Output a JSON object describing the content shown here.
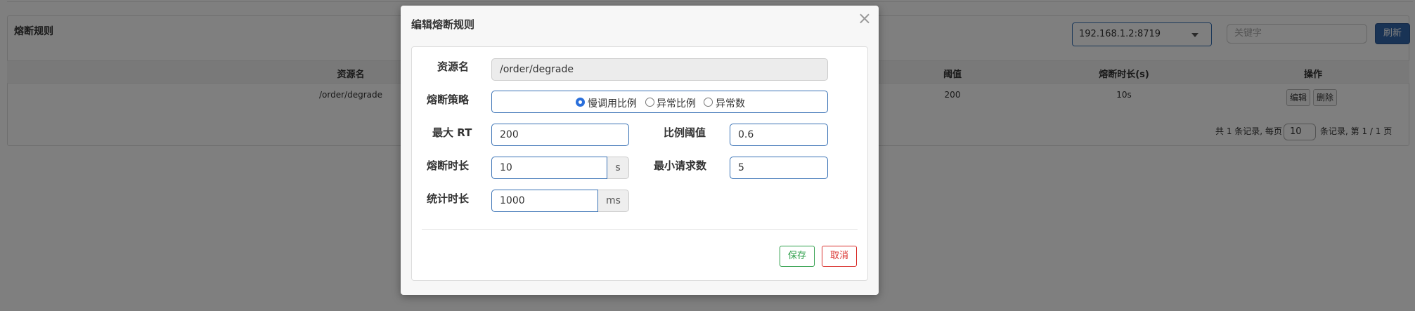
{
  "page": {
    "panel_title": "熔断规则",
    "machine_select": "192.168.1.2:8719",
    "keyword_placeholder": "关键字",
    "refresh_label": "刷新",
    "table": {
      "headers": [
        "资源名",
        "阈值",
        "熔断时长(s)",
        "操作"
      ],
      "rows": [
        {
          "resource": "/order/degrade",
          "threshold": "200",
          "duration": "10s",
          "edit": "编辑",
          "delete": "删除"
        }
      ]
    },
    "pager": {
      "prefix": "共 1 条记录, 每页",
      "page_size": "10",
      "suffix": "条记录, 第 1 / 1 页"
    }
  },
  "modal": {
    "title": "编辑熔断规则",
    "close_icon": "×",
    "fields": {
      "resource_label": "资源名",
      "resource_value": "/order/degrade",
      "strategy_label": "熔断策略",
      "strategy_options": [
        "慢调用比例",
        "异常比例",
        "异常数"
      ],
      "strategy_selected": "慢调用比例",
      "max_rt_label": "最大 RT",
      "max_rt_value": "200",
      "ratio_label": "比例阈值",
      "ratio_value": "0.6",
      "duration_label": "熔断时长",
      "duration_value": "10",
      "duration_unit": "s",
      "min_request_label": "最小请求数",
      "min_request_value": "5",
      "stat_label": "统计时长",
      "stat_value": "1000",
      "stat_unit": "ms"
    },
    "save_label": "保存",
    "cancel_label": "取消"
  },
  "colors": {
    "primary": "#3366aa",
    "save": "#2e9e4a",
    "cancel": "#d9302c",
    "radio": "#2a6fdb"
  }
}
